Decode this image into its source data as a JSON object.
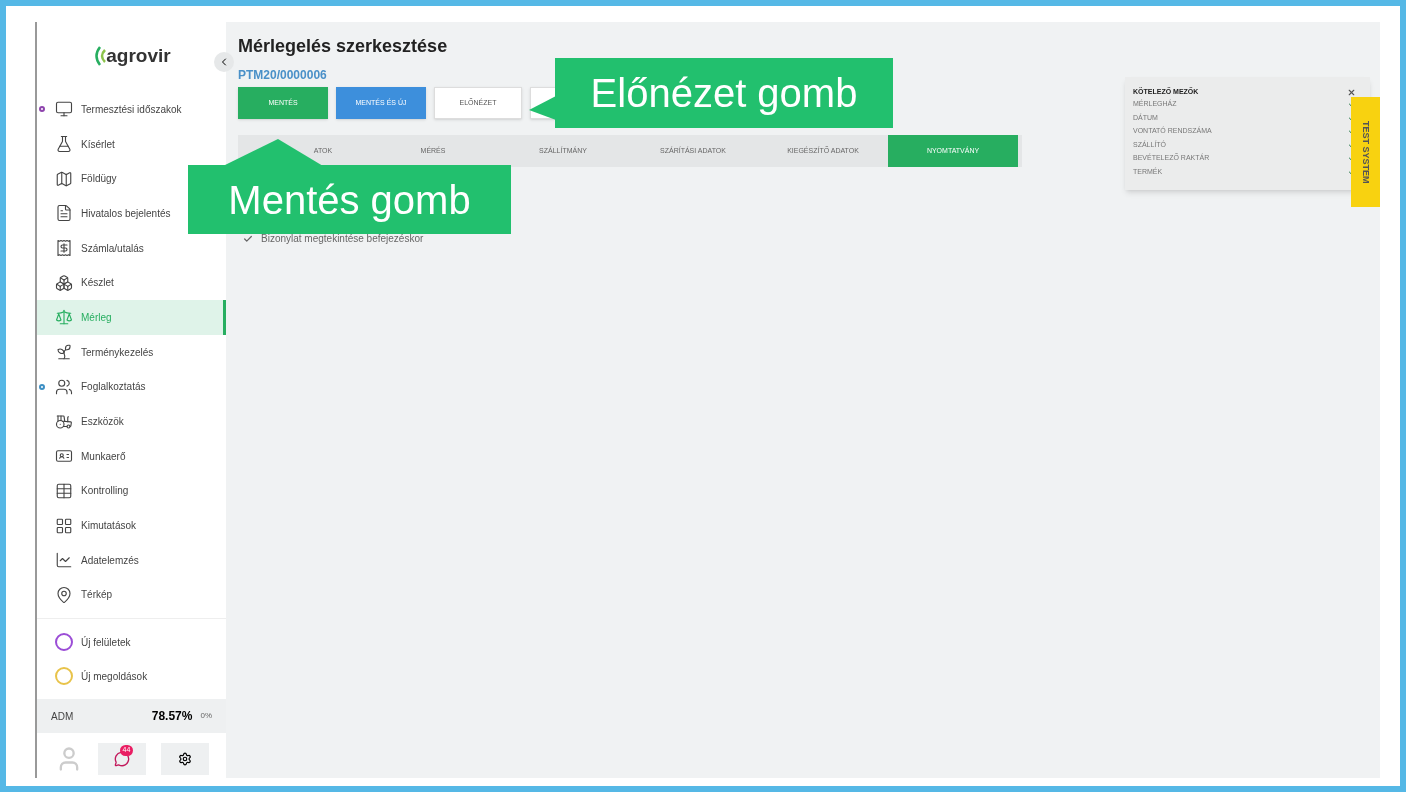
{
  "sidebar": {
    "logo": "agrovir",
    "items": [
      {
        "label": "Termesztési időszakok",
        "selected": false,
        "color": "#8e44ad"
      },
      {
        "label": "Kísérlet",
        "selected": false
      },
      {
        "label": "Földügy",
        "selected": false
      },
      {
        "label": "Hivatalos bejelentés",
        "selected": false
      },
      {
        "label": "Számla/utalás",
        "selected": false
      },
      {
        "label": "Készlet",
        "selected": false
      },
      {
        "label": "Mérleg",
        "selected": true
      },
      {
        "label": "Terménykezelés",
        "selected": false
      },
      {
        "label": "Foglalkoztatás",
        "selected": false,
        "color": "#3d8fc4"
      },
      {
        "label": "Eszközök",
        "selected": false
      },
      {
        "label": "Munkaerő",
        "selected": false
      },
      {
        "label": "Kontrolling",
        "selected": false
      },
      {
        "label": "Kimutatások",
        "selected": false
      },
      {
        "label": "Adatelemzés",
        "selected": false
      },
      {
        "label": "Térkép",
        "selected": false
      }
    ],
    "new_items": [
      {
        "label": "Új felületek",
        "color": "#9b4dd6"
      },
      {
        "label": "Új megoldások",
        "color": "#e8c34a"
      }
    ],
    "footer": {
      "user": "ADM",
      "percent": "78.57%",
      "extra": "0%",
      "chat_badge": "44"
    }
  },
  "page": {
    "title": "Mérlegelés szerkesztése",
    "record_id": "PTM20/0000006",
    "buttons": [
      {
        "label": "MENTÉS",
        "kind": "save"
      },
      {
        "label": "MENTÉS ÉS ÚJ",
        "kind": "save_new"
      },
      {
        "label": "ELŐNÉZET",
        "kind": "outline"
      },
      {
        "kind": "outline"
      }
    ],
    "tabs": [
      {
        "label": "ATOK",
        "selected": false
      },
      {
        "label": "MÉRÉS",
        "selected": false
      },
      {
        "label": "SZÁLLÍTMÁNY",
        "selected": false
      },
      {
        "label": "SZÁRÍTÁSI ADATOK",
        "selected": false
      },
      {
        "label": "KIEGÉSZÍTŐ ADATOK",
        "selected": false
      },
      {
        "label": "NYOMTATVÁNY",
        "selected": true
      }
    ],
    "checkbox": {
      "label": "Bizonylat megtekintése befejezéskor",
      "checked": true
    },
    "required_fields": {
      "title": "KÖTELEZŐ MEZŐK",
      "items": [
        {
          "label": "MÉRLEGHÁZ",
          "checked": true
        },
        {
          "label": "DÁTUM",
          "checked": true
        },
        {
          "label": "VONTATÓ RENDSZÁMA",
          "checked": true
        },
        {
          "label": "SZÁLLÍTÓ",
          "checked": true
        },
        {
          "label": "BEVÉTELEZŐ RAKTÁR",
          "checked": true
        },
        {
          "label": "TERMÉK",
          "checked": true
        }
      ]
    },
    "test_badge": "TEST SYSTEM"
  },
  "callouts": [
    {
      "text": "Előnézet gomb",
      "kind": "left"
    },
    {
      "text": "Mentés gomb",
      "kind": "up"
    }
  ]
}
